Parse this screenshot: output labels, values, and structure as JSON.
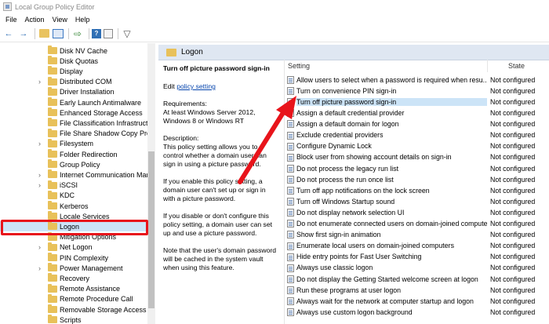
{
  "window": {
    "title": "Local Group Policy Editor"
  },
  "menu": [
    "File",
    "Action",
    "View",
    "Help"
  ],
  "toolbar": {
    "icons": [
      "back-arrow-icon",
      "forward-arrow-icon",
      "up-folder-icon",
      "show-hide-tree-icon",
      "export-list-icon",
      "help-icon",
      "properties-icon",
      "filter-icon"
    ]
  },
  "tree": {
    "items": [
      {
        "label": "Disk NV Cache",
        "expandable": false
      },
      {
        "label": "Disk Quotas",
        "expandable": false
      },
      {
        "label": "Display",
        "expandable": false
      },
      {
        "label": "Distributed COM",
        "expandable": true
      },
      {
        "label": "Driver Installation",
        "expandable": false
      },
      {
        "label": "Early Launch Antimalware",
        "expandable": false
      },
      {
        "label": "Enhanced Storage Access",
        "expandable": false
      },
      {
        "label": "File Classification Infrastructu",
        "expandable": false
      },
      {
        "label": "File Share Shadow Copy Prov",
        "expandable": false
      },
      {
        "label": "Filesystem",
        "expandable": true
      },
      {
        "label": "Folder Redirection",
        "expandable": false
      },
      {
        "label": "Group Policy",
        "expandable": false
      },
      {
        "label": "Internet Communication Man",
        "expandable": true
      },
      {
        "label": "iSCSI",
        "expandable": true
      },
      {
        "label": "KDC",
        "expandable": false
      },
      {
        "label": "Kerberos",
        "expandable": false
      },
      {
        "label": "Locale Services",
        "expandable": false
      },
      {
        "label": "Logon",
        "expandable": false
      },
      {
        "label": "Mitigation Options",
        "expandable": false
      },
      {
        "label": "Net Logon",
        "expandable": true
      },
      {
        "label": "PIN Complexity",
        "expandable": false
      },
      {
        "label": "Power Management",
        "expandable": true
      },
      {
        "label": "Recovery",
        "expandable": false
      },
      {
        "label": "Remote Assistance",
        "expandable": false
      },
      {
        "label": "Remote Procedure Call",
        "expandable": false
      },
      {
        "label": "Removable Storage Access",
        "expandable": false
      },
      {
        "label": "Scripts",
        "expandable": false
      }
    ],
    "selected_index": 17
  },
  "pane": {
    "header": "Logon",
    "description": {
      "title": "Turn off picture password sign-in",
      "edit_prefix": "Edit ",
      "edit_link": "policy setting",
      "requirements": "Requirements:\nAt least Windows Server 2012, Windows 8 or Windows RT",
      "desc1": "Description:\nThis policy setting allows you to control whether a domain user can sign in using a picture password.",
      "desc2": "If you enable this policy setting, a domain user can't set up or sign in with a picture password.",
      "desc3": "If you disable or don't configure this policy setting, a domain user can set up and use a picture password.",
      "desc4": "Note that the user's domain password will be cached in the system vault when using this feature."
    },
    "columns": {
      "setting": "Setting",
      "state": "State"
    },
    "settings": [
      {
        "name": "Allow users to select when a password is required when resu...",
        "state": "Not configured"
      },
      {
        "name": "Turn on convenience PIN sign-in",
        "state": "Not configured"
      },
      {
        "name": "Turn off picture password sign-in",
        "state": "Not configured"
      },
      {
        "name": "Assign a default credential provider",
        "state": "Not configured"
      },
      {
        "name": "Assign a default domain for logon",
        "state": "Not configured"
      },
      {
        "name": "Exclude credential providers",
        "state": "Not configured"
      },
      {
        "name": "Configure Dynamic Lock",
        "state": "Not configured"
      },
      {
        "name": "Block user from showing account details on sign-in",
        "state": "Not configured"
      },
      {
        "name": "Do not process the legacy run list",
        "state": "Not configured"
      },
      {
        "name": "Do not process the run once list",
        "state": "Not configured"
      },
      {
        "name": "Turn off app notifications on the lock screen",
        "state": "Not configured"
      },
      {
        "name": "Turn off Windows Startup sound",
        "state": "Not configured"
      },
      {
        "name": "Do not display network selection UI",
        "state": "Not configured"
      },
      {
        "name": "Do not enumerate connected users on domain-joined compute...",
        "state": "Not configured"
      },
      {
        "name": "Show first sign-in animation",
        "state": "Not configured"
      },
      {
        "name": "Enumerate local users on domain-joined computers",
        "state": "Not configured"
      },
      {
        "name": "Hide entry points for Fast User Switching",
        "state": "Not configured"
      },
      {
        "name": "Always use classic logon",
        "state": "Not configured"
      },
      {
        "name": "Do not display the Getting Started welcome screen at logon",
        "state": "Not configured"
      },
      {
        "name": "Run these programs at user logon",
        "state": "Not configured"
      },
      {
        "name": "Always wait for the network at computer startup and logon",
        "state": "Not configured"
      },
      {
        "name": "Always use custom logon background",
        "state": "Not configured"
      }
    ],
    "selected_setting": 2
  },
  "annotation_color": "#e8141b"
}
